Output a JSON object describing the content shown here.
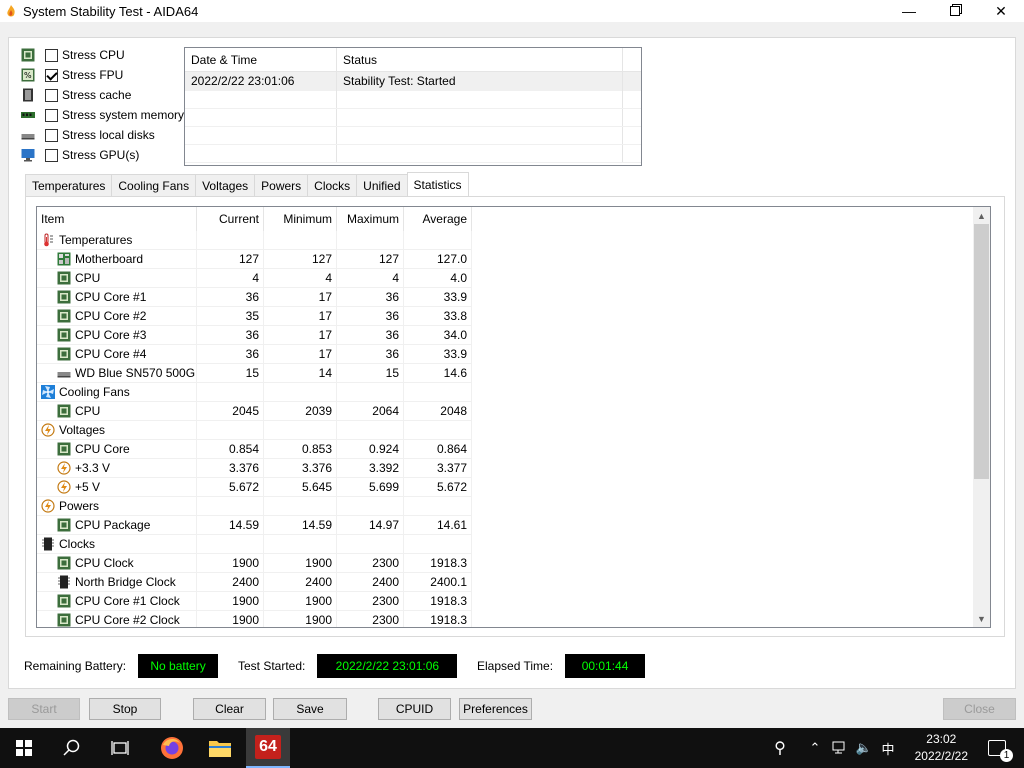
{
  "window": {
    "title": "System Stability Test - AIDA64"
  },
  "stress": [
    {
      "label": "Stress CPU",
      "checked": false,
      "icon": "cpu-chip-icon"
    },
    {
      "label": "Stress FPU",
      "checked": true,
      "icon": "fpu-chip-icon"
    },
    {
      "label": "Stress cache",
      "checked": false,
      "icon": "cache-icon"
    },
    {
      "label": "Stress system memory",
      "checked": false,
      "icon": "memory-module-icon"
    },
    {
      "label": "Stress local disks",
      "checked": false,
      "icon": "disk-drive-icon"
    },
    {
      "label": "Stress GPU(s)",
      "checked": false,
      "icon": "monitor-icon"
    }
  ],
  "log": {
    "headers": [
      "Date & Time",
      "Status"
    ],
    "rows": [
      {
        "time": "2022/2/22 23:01:06",
        "status": "Stability Test: Started"
      }
    ]
  },
  "tabs": [
    "Temperatures",
    "Cooling Fans",
    "Voltages",
    "Powers",
    "Clocks",
    "Unified",
    "Statistics"
  ],
  "active_tab": "Statistics",
  "stats": {
    "headers": [
      "Item",
      "Current",
      "Minimum",
      "Maximum",
      "Average"
    ],
    "rows": [
      {
        "kind": "cat",
        "icon": "thermometer-icon",
        "item": "Temperatures",
        "cur": "",
        "min": "",
        "max": "",
        "avg": ""
      },
      {
        "kind": "sub",
        "icon": "motherboard-icon",
        "item": "Motherboard",
        "cur": "127",
        "min": "127",
        "max": "127",
        "avg": "127.0"
      },
      {
        "kind": "sub",
        "icon": "cpu-chip-icon",
        "item": "CPU",
        "cur": "4",
        "min": "4",
        "max": "4",
        "avg": "4.0"
      },
      {
        "kind": "sub",
        "icon": "cpu-chip-icon",
        "item": "CPU Core #1",
        "cur": "36",
        "min": "17",
        "max": "36",
        "avg": "33.9"
      },
      {
        "kind": "sub",
        "icon": "cpu-chip-icon",
        "item": "CPU Core #2",
        "cur": "35",
        "min": "17",
        "max": "36",
        "avg": "33.8"
      },
      {
        "kind": "sub",
        "icon": "cpu-chip-icon",
        "item": "CPU Core #3",
        "cur": "36",
        "min": "17",
        "max": "36",
        "avg": "34.0"
      },
      {
        "kind": "sub",
        "icon": "cpu-chip-icon",
        "item": "CPU Core #4",
        "cur": "36",
        "min": "17",
        "max": "36",
        "avg": "33.9"
      },
      {
        "kind": "sub",
        "icon": "disk-drive-icon",
        "item": "WD Blue SN570 500G...",
        "cur": "15",
        "min": "14",
        "max": "15",
        "avg": "14.6"
      },
      {
        "kind": "cat",
        "icon": "fan-icon",
        "item": "Cooling Fans",
        "cur": "",
        "min": "",
        "max": "",
        "avg": ""
      },
      {
        "kind": "sub",
        "icon": "cpu-chip-icon",
        "item": "CPU",
        "cur": "2045",
        "min": "2039",
        "max": "2064",
        "avg": "2048"
      },
      {
        "kind": "cat",
        "icon": "voltage-icon",
        "item": "Voltages",
        "cur": "",
        "min": "",
        "max": "",
        "avg": ""
      },
      {
        "kind": "sub",
        "icon": "cpu-chip-icon",
        "item": "CPU Core",
        "cur": "0.854",
        "min": "0.853",
        "max": "0.924",
        "avg": "0.864"
      },
      {
        "kind": "sub",
        "icon": "voltage-icon",
        "item": "+3.3 V",
        "cur": "3.376",
        "min": "3.376",
        "max": "3.392",
        "avg": "3.377"
      },
      {
        "kind": "sub",
        "icon": "voltage-icon",
        "item": "+5 V",
        "cur": "5.672",
        "min": "5.645",
        "max": "5.699",
        "avg": "5.672"
      },
      {
        "kind": "cat",
        "icon": "voltage-icon",
        "item": "Powers",
        "cur": "",
        "min": "",
        "max": "",
        "avg": ""
      },
      {
        "kind": "sub",
        "icon": "cpu-chip-icon",
        "item": "CPU Package",
        "cur": "14.59",
        "min": "14.59",
        "max": "14.97",
        "avg": "14.61"
      },
      {
        "kind": "cat",
        "icon": "clock-chip-icon",
        "item": "Clocks",
        "cur": "",
        "min": "",
        "max": "",
        "avg": ""
      },
      {
        "kind": "sub",
        "icon": "cpu-chip-icon",
        "item": "CPU Clock",
        "cur": "1900",
        "min": "1900",
        "max": "2300",
        "avg": "1918.3"
      },
      {
        "kind": "sub",
        "icon": "clock-chip-icon",
        "item": "North Bridge Clock",
        "cur": "2400",
        "min": "2400",
        "max": "2400",
        "avg": "2400.1"
      },
      {
        "kind": "sub",
        "icon": "cpu-chip-icon",
        "item": "CPU Core #1 Clock",
        "cur": "1900",
        "min": "1900",
        "max": "2300",
        "avg": "1918.3"
      },
      {
        "kind": "sub",
        "icon": "cpu-chip-icon",
        "item": "CPU Core #2 Clock",
        "cur": "1900",
        "min": "1900",
        "max": "2300",
        "avg": "1918.3"
      }
    ]
  },
  "status": {
    "battery_label": "Remaining Battery:",
    "battery_value": "No battery",
    "started_label": "Test Started:",
    "started_value": "2022/2/22 23:01:06",
    "elapsed_label": "Elapsed Time:",
    "elapsed_value": "00:01:44"
  },
  "buttons": {
    "start": "Start",
    "stop": "Stop",
    "clear": "Clear",
    "save": "Save",
    "cpuid": "CPUID",
    "preferences": "Preferences",
    "close": "Close"
  },
  "taskbar": {
    "time": "23:02",
    "date": "2022/2/22",
    "ime": "中",
    "notification_count": "1",
    "aida_label": "64"
  },
  "colors": {
    "lcd_text": "#00ff00",
    "lcd_bg": "#000000",
    "taskbar_bg": "#101010"
  }
}
